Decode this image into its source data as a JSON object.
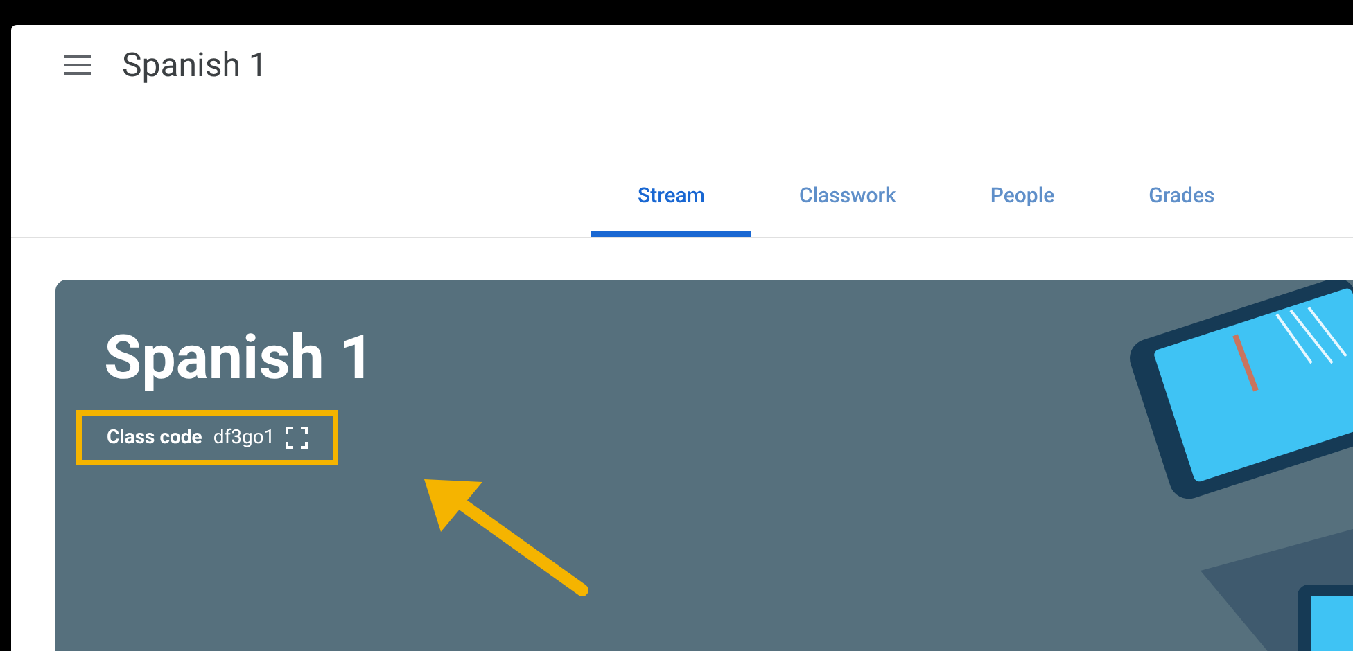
{
  "header": {
    "title": "Spanish 1"
  },
  "tabs": [
    {
      "label": "Stream",
      "selected": true
    },
    {
      "label": "Classwork",
      "selected": false
    },
    {
      "label": "People",
      "selected": false
    },
    {
      "label": "Grades",
      "selected": false
    }
  ],
  "banner": {
    "title": "Spanish 1",
    "class_code": {
      "label": "Class code",
      "value": "df3go1",
      "highlighted": true
    }
  }
}
